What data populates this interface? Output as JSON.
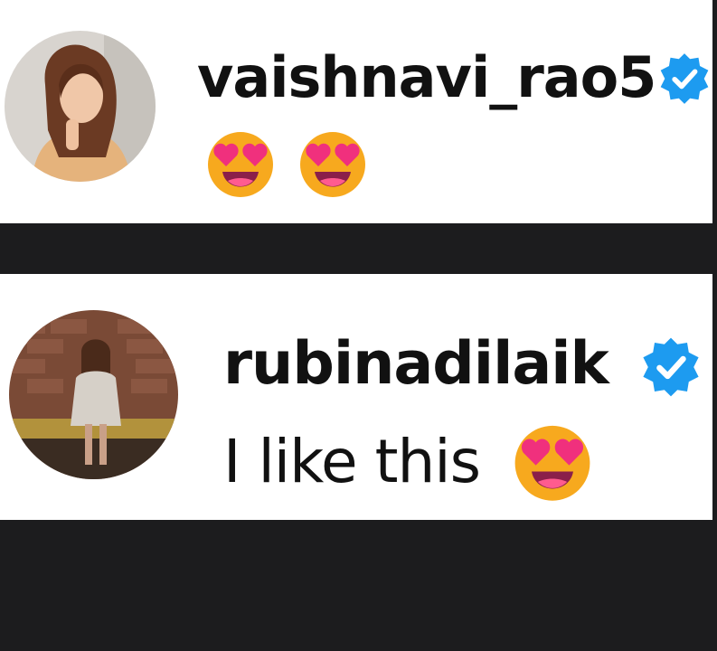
{
  "comments": [
    {
      "username": "vaishnavi_rao5",
      "verified": true,
      "text": "",
      "emojis": [
        "smiling-face-with-heart-eyes",
        "smiling-face-with-heart-eyes"
      ]
    },
    {
      "username": "rubinadilaik",
      "verified": true,
      "text": "I like this",
      "emojis": [
        "smiling-face-with-heart-eyes"
      ]
    }
  ],
  "colors": {
    "background": "#1c1c1e",
    "card": "#ffffff",
    "text": "#111111",
    "verified_badge": "#1d9bf0",
    "emoji_face": "#f7a91e",
    "emoji_hearts": "#f0307d"
  }
}
